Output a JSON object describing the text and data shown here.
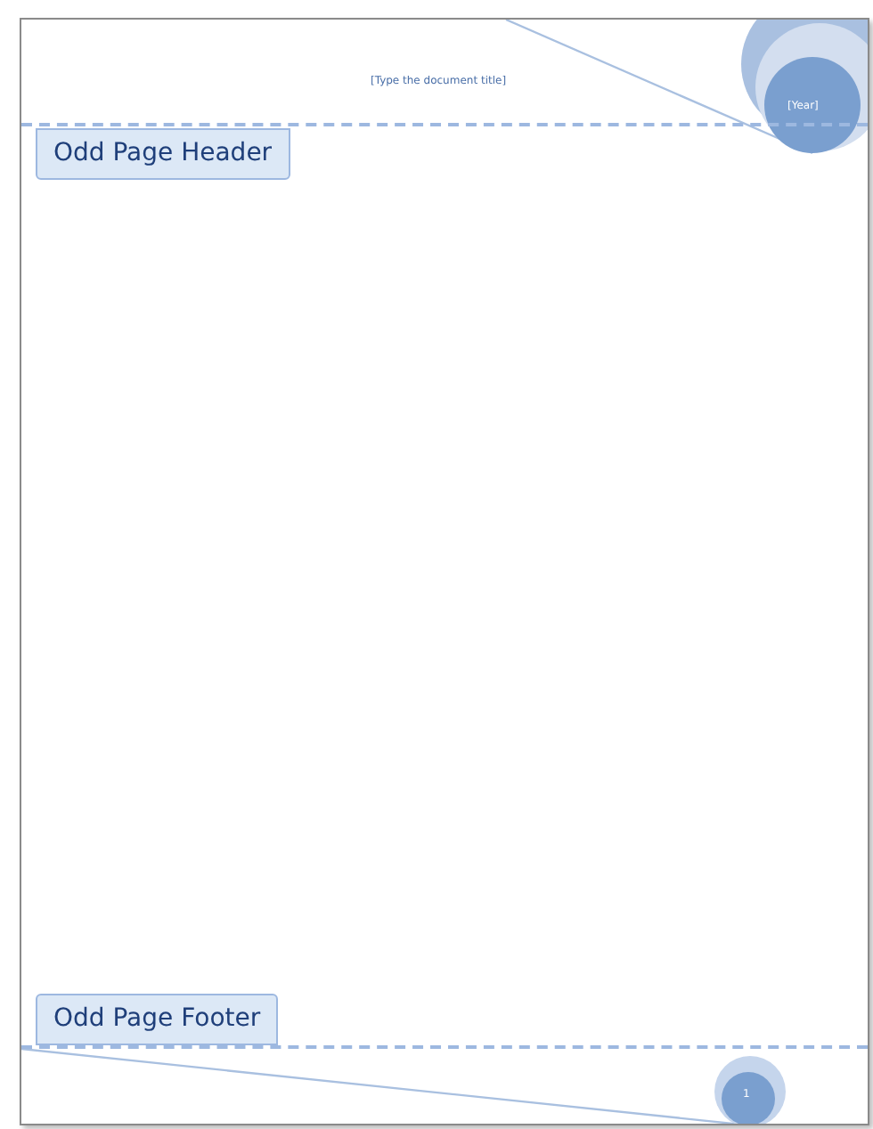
{
  "header": {
    "title_placeholder": "[Type the document title]",
    "year_placeholder": "[Year]",
    "label": "Odd Page Header"
  },
  "footer": {
    "label": "Odd Page Footer",
    "page_number": "1"
  }
}
